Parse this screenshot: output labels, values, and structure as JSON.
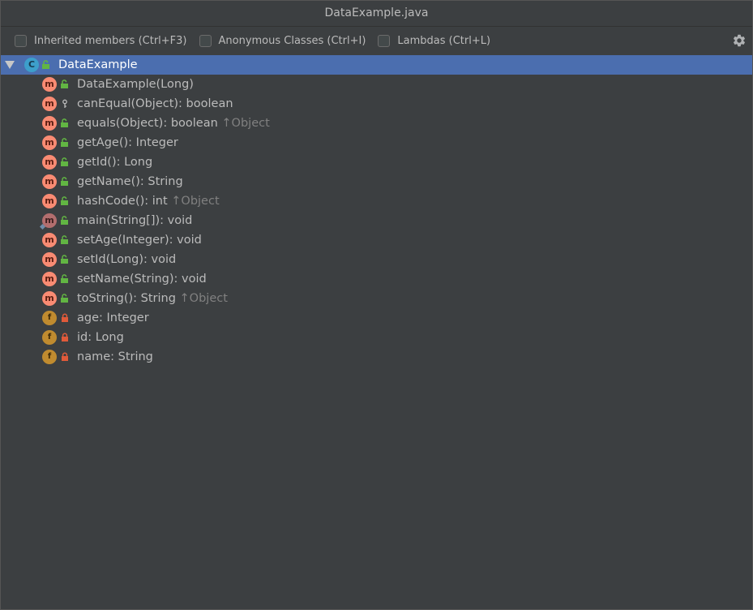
{
  "window": {
    "title": "DataExample.java"
  },
  "toolbar": {
    "inherited_label": "Inherited members (Ctrl+F3)",
    "inherited_checked": false,
    "anonymous_label": "Anonymous Classes (Ctrl+I)",
    "anonymous_checked": false,
    "lambdas_label": "Lambdas (Ctrl+L)",
    "lambdas_checked": false,
    "settings_icon": "gear-icon"
  },
  "tree": {
    "root": {
      "label": "DataExample",
      "icon": "class-icon",
      "expanded": true,
      "selected": true
    },
    "members": [
      {
        "kind": "method",
        "access": "public",
        "name": "DataExample(Long)",
        "inherit": ""
      },
      {
        "kind": "method",
        "access": "protected",
        "name": "canEqual(Object): boolean",
        "inherit": ""
      },
      {
        "kind": "method",
        "access": "public",
        "name": "equals(Object): boolean",
        "inherit": "↑Object"
      },
      {
        "kind": "method",
        "access": "public",
        "name": "getAge(): Integer",
        "inherit": ""
      },
      {
        "kind": "method",
        "access": "public",
        "name": "getId(): Long",
        "inherit": ""
      },
      {
        "kind": "method",
        "access": "public",
        "name": "getName(): String",
        "inherit": ""
      },
      {
        "kind": "method",
        "access": "public",
        "name": "hashCode(): int",
        "inherit": "↑Object"
      },
      {
        "kind": "static-method",
        "access": "public",
        "name": "main(String[]): void",
        "inherit": ""
      },
      {
        "kind": "method",
        "access": "public",
        "name": "setAge(Integer): void",
        "inherit": ""
      },
      {
        "kind": "method",
        "access": "public",
        "name": "setId(Long): void",
        "inherit": ""
      },
      {
        "kind": "method",
        "access": "public",
        "name": "setName(String): void",
        "inherit": ""
      },
      {
        "kind": "method",
        "access": "public",
        "name": "toString(): String",
        "inherit": "↑Object"
      },
      {
        "kind": "field",
        "access": "private",
        "name": "age: Integer",
        "inherit": ""
      },
      {
        "kind": "field",
        "access": "private",
        "name": "id: Long",
        "inherit": ""
      },
      {
        "kind": "field",
        "access": "private",
        "name": "name: String",
        "inherit": ""
      }
    ]
  },
  "colors": {
    "background": "#3c3f41",
    "selection": "#4b6eaf",
    "text": "#bbbbbb",
    "inherit_text": "#808080",
    "method_badge": "#f98b73",
    "field_badge": "#c08b2f",
    "class_badge": "#3d9fcb",
    "public_access": "#62b543",
    "private_access": "#e05a3a"
  }
}
